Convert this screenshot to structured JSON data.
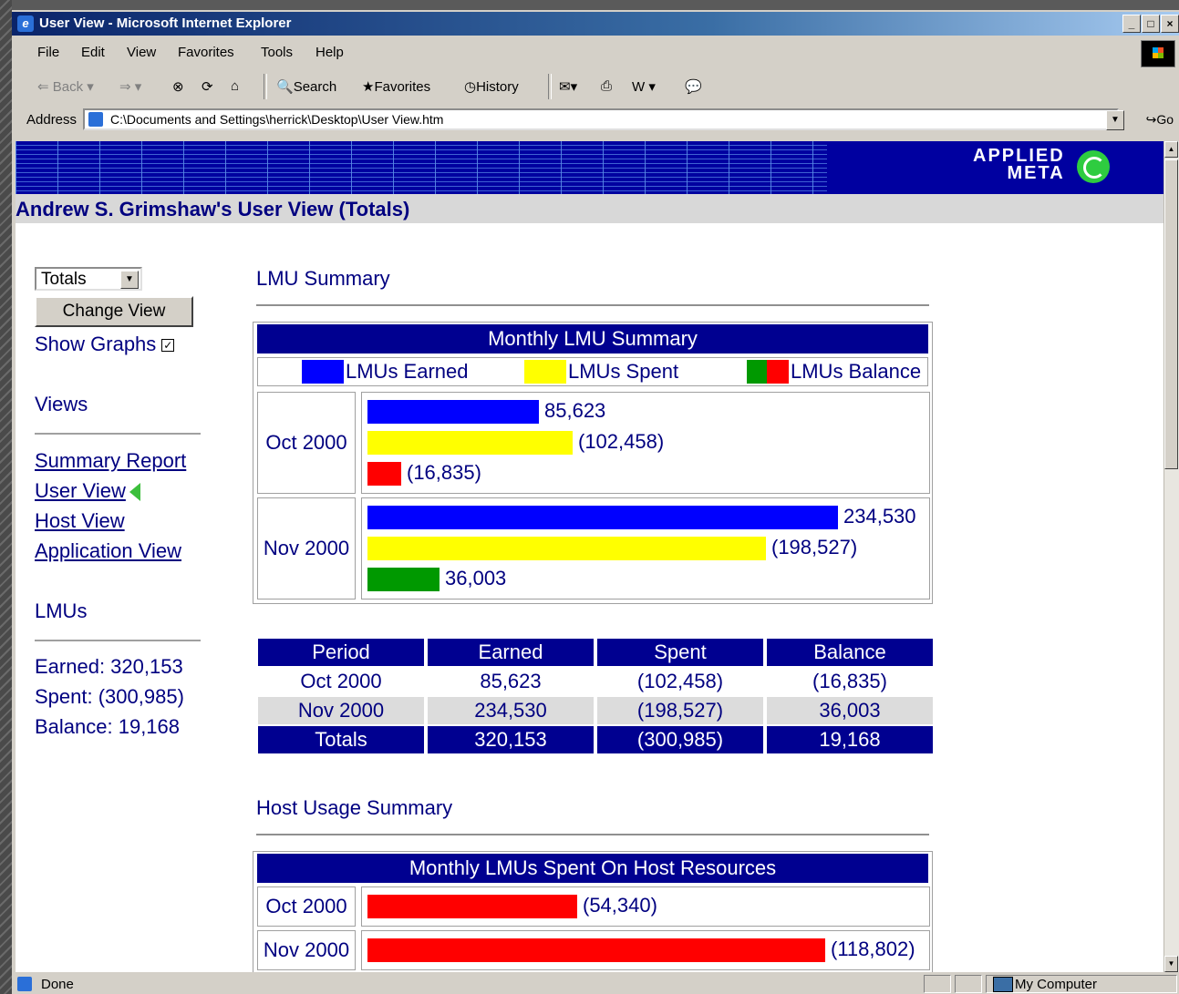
{
  "window": {
    "title": "User View - Microsoft Internet Explorer",
    "min": "_",
    "max": "□",
    "close": "×"
  },
  "menu": {
    "file": "File",
    "edit": "Edit",
    "view": "View",
    "favorites": "Favorites",
    "tools": "Tools",
    "help": "Help"
  },
  "toolbar": {
    "back": "Back",
    "search": "Search",
    "favorites": "Favorites",
    "history": "History"
  },
  "address": {
    "label": "Address",
    "value": "C:\\Documents and Settings\\herrick\\Desktop\\User View.htm",
    "go": "Go"
  },
  "brand": {
    "line1": "APPLIED",
    "line2": "META"
  },
  "page": {
    "title": "Andrew S. Grimshaw's User View (Totals)"
  },
  "sidebar": {
    "select_value": "Totals",
    "change_view": "Change View",
    "show_graphs": "Show Graphs",
    "show_graphs_checked": true,
    "views_heading": "Views",
    "links": [
      "Summary Report",
      "User View",
      "Host View",
      "Application View"
    ],
    "lmus_heading": "LMUs",
    "earned": "Earned: 320,153",
    "spent": "Spent: (300,985)",
    "balance": "Balance: 19,168"
  },
  "lmu_summary": {
    "section_title": "LMU Summary",
    "chart_title": "Monthly LMU Summary",
    "legend": [
      "LMUs Earned",
      "LMUs Spent",
      "LMUs Balance"
    ],
    "rows": [
      {
        "period": "Oct 2000",
        "earned": "85,623",
        "spent": "(102,458)",
        "balance": "(16,835)"
      },
      {
        "period": "Nov 2000",
        "earned": "234,530",
        "spent": "(198,527)",
        "balance": "36,003"
      }
    ]
  },
  "summary_table": {
    "headers": [
      "Period",
      "Earned",
      "Spent",
      "Balance"
    ],
    "rows": [
      [
        "Oct 2000",
        "85,623",
        "(102,458)",
        "(16,835)"
      ],
      [
        "Nov 2000",
        "234,530",
        "(198,527)",
        "36,003"
      ]
    ],
    "totals": [
      "Totals",
      "320,153",
      "(300,985)",
      "19,168"
    ]
  },
  "host_usage": {
    "section_title": "Host Usage Summary",
    "chart_title": "Monthly LMUs Spent On Host Resources",
    "rows": [
      {
        "period": "Oct 2000",
        "value": "(54,340)"
      },
      {
        "period": "Nov 2000",
        "value": "(118,802)"
      }
    ]
  },
  "status": {
    "text": "Done",
    "zone": "My Computer"
  },
  "colors": {
    "earned": "#0000ff",
    "spent": "#ffff00",
    "balance_negative": "#ff0000",
    "balance_positive": "#009900",
    "header": "#000090"
  },
  "chart_data": [
    {
      "type": "bar",
      "title": "Monthly LMU Summary",
      "categories": [
        "Oct 2000",
        "Nov 2000"
      ],
      "series": [
        {
          "name": "LMUs Earned",
          "values": [
            85623,
            234530
          ]
        },
        {
          "name": "LMUs Spent",
          "values": [
            -102458,
            -198527
          ]
        },
        {
          "name": "LMUs Balance",
          "values": [
            -16835,
            36003
          ]
        }
      ]
    },
    {
      "type": "bar",
      "title": "Monthly LMUs Spent On Host Resources",
      "categories": [
        "Oct 2000",
        "Nov 2000"
      ],
      "values": [
        -54340,
        -118802
      ]
    }
  ]
}
